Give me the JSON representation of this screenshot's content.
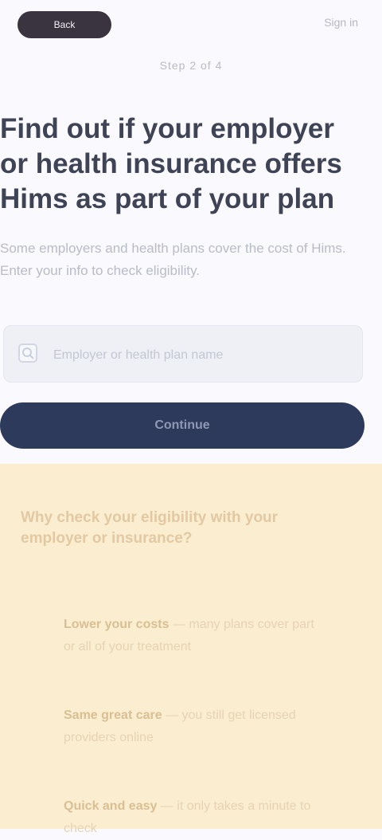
{
  "header": {
    "back_label": "Back",
    "signin_label": "Sign in",
    "step_label": "Step 2 of 4"
  },
  "main": {
    "headline": "Find out if your employer or health insurance offers Hims as part of your plan",
    "subtext": "Some employers and health plans cover the cost of Hims. Enter your info to check eligibility.",
    "input_placeholder": "Employer or health plan name",
    "cta_label": "Continue"
  },
  "info": {
    "title": "Why check your eligibility with your employer or insurance?",
    "items": [
      {
        "bold": "Lower your costs",
        "text": " — many plans cover part or all of your treatment"
      },
      {
        "bold": "Same great care",
        "text": " — you still get licensed providers online"
      },
      {
        "bold": "Quick and easy",
        "text": " — it only takes a minute to check"
      }
    ]
  },
  "colors": {
    "cta": "#2e3a5c",
    "panel": "#fbedcf",
    "pill": "#3a3340"
  }
}
